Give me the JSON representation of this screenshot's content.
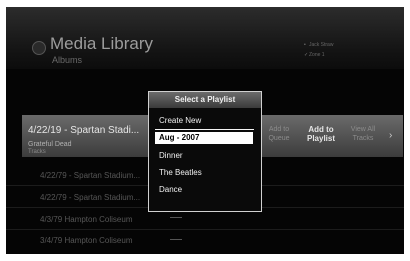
{
  "header": {
    "title": "Media Library",
    "subtitle": "Albums",
    "options": [
      "Jack Straw",
      "Zone 1"
    ]
  },
  "selected_row": {
    "title": "4/22/19 - Spartan Stadi...",
    "artist": "Grateful Dead",
    "tracks": "Tracks"
  },
  "actions": {
    "add_to_queue": [
      "Add to",
      "Queue"
    ],
    "add_to_playlist": [
      "Add to",
      "Playlist"
    ],
    "view_all_tracks": [
      "View All",
      "Tracks"
    ]
  },
  "rows": [
    "4/22/79 - Spartan Stadium...",
    "4/22/79 - Spartan Stadium...",
    "4/3/79 Hampton Coliseum",
    "3/4/79 Hampton Coliseum"
  ],
  "dialog": {
    "title": "Select a Playlist",
    "items": [
      "Create New",
      "Aug - 2007",
      "Dinner",
      "The Beatles",
      "Dance"
    ],
    "selected_index": 1
  }
}
